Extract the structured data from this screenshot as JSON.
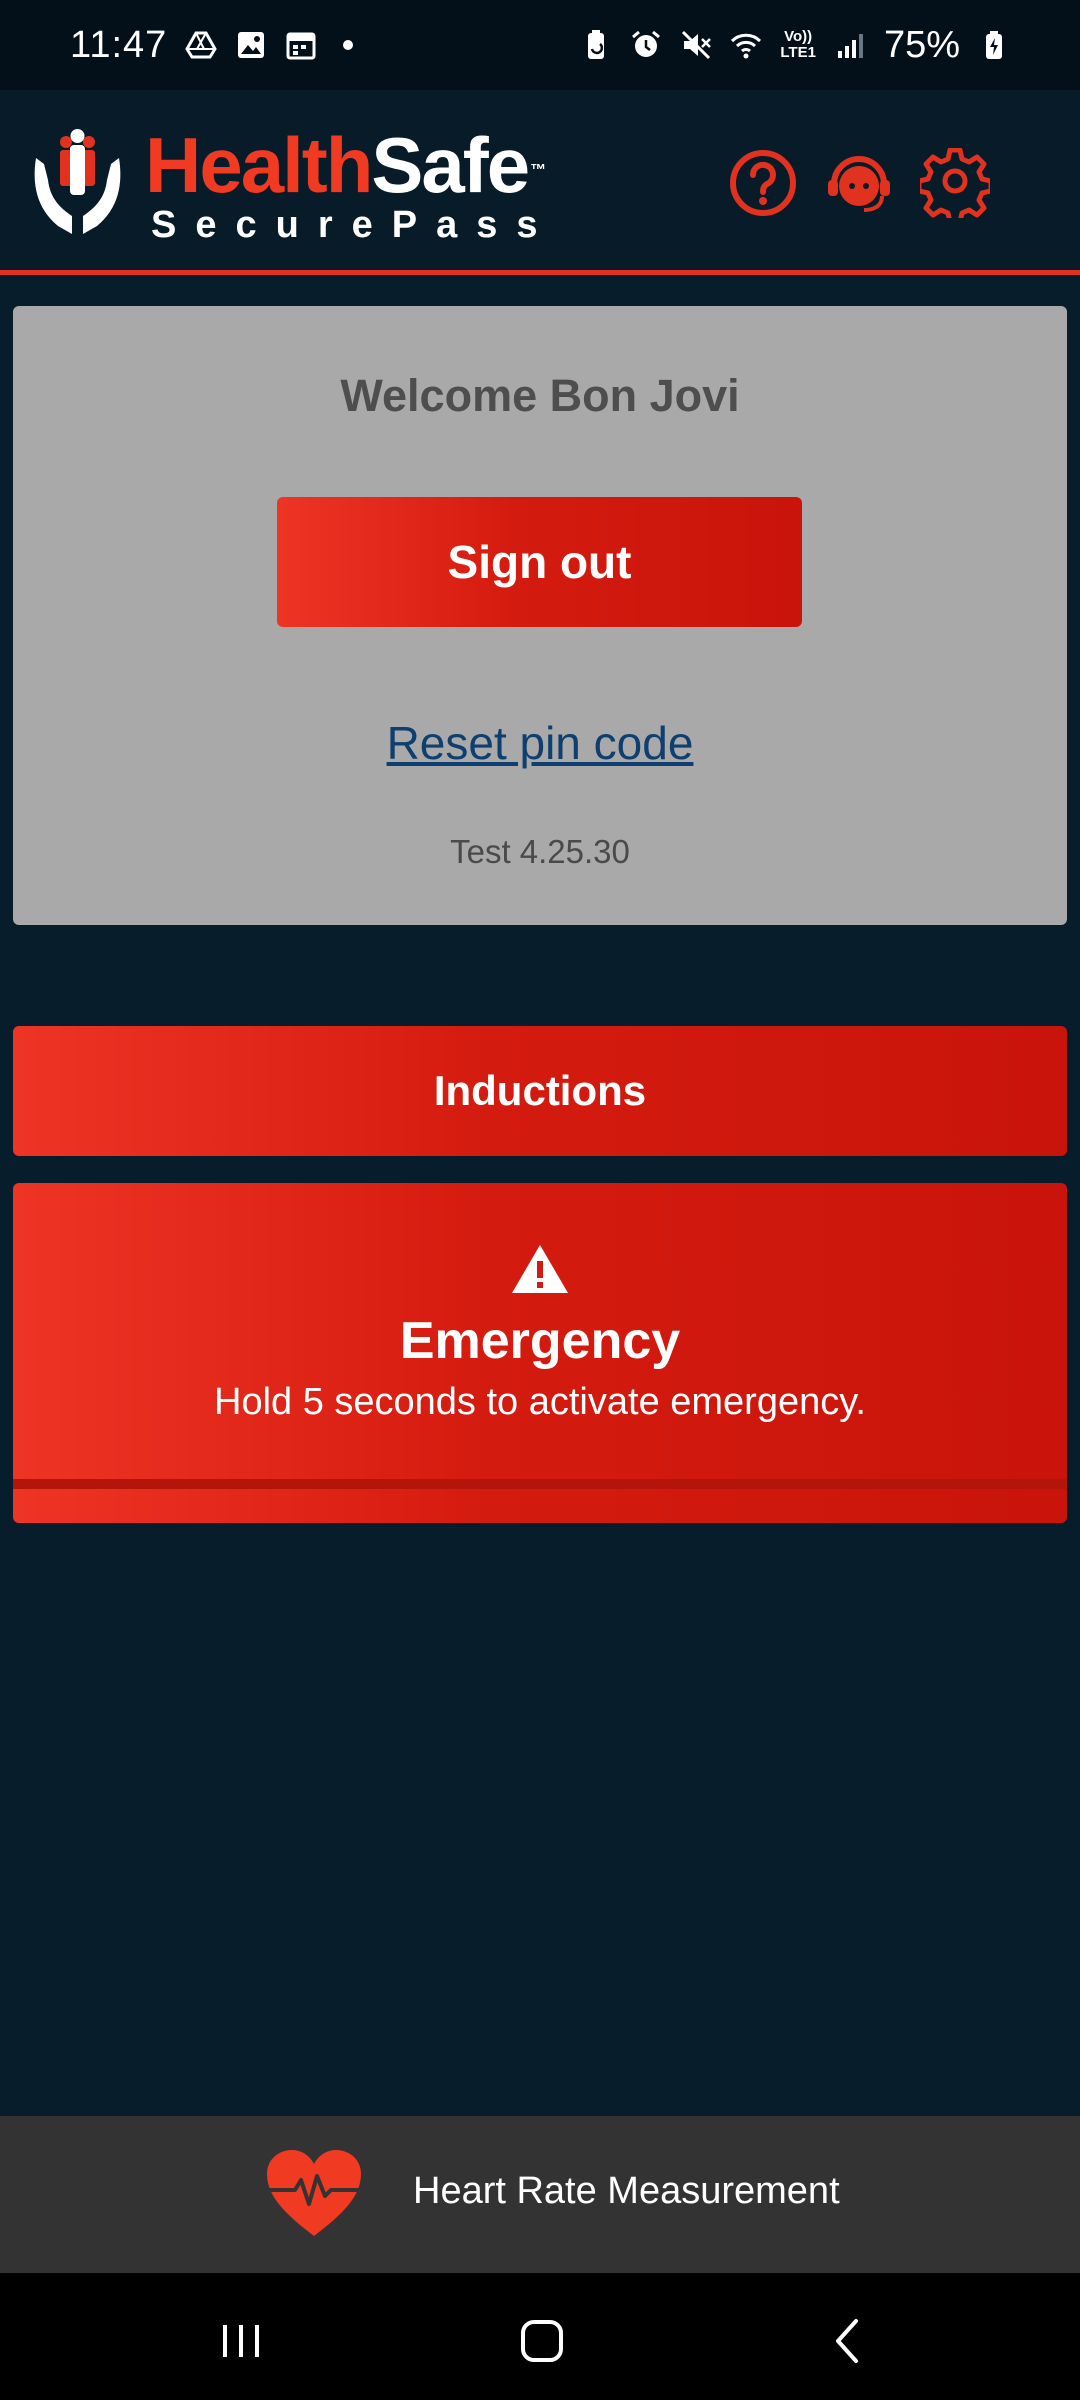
{
  "status_bar": {
    "time": "11:47",
    "battery": "75%",
    "left_icons": [
      "drive-icon",
      "gallery-icon",
      "calendar-icon",
      "dot"
    ],
    "right_icons": [
      "battery-saver-icon",
      "alarm-icon",
      "mute-icon",
      "wifi-icon",
      "volte-lte1-icon",
      "signal-icon",
      "charging-battery-icon"
    ],
    "volte_text": "Vo))",
    "lte_text": "LTE1"
  },
  "header": {
    "logo_health": "Health",
    "logo_safe": "Safe",
    "logo_tm": "™",
    "logo_sub": "SecurePass",
    "icons": [
      "help-icon",
      "support-agent-icon",
      "settings-icon"
    ]
  },
  "welcome_card": {
    "welcome_text": "Welcome Bon Jovi",
    "signout_label": "Sign out",
    "reset_label": "Reset pin code",
    "version": "Test 4.25.30"
  },
  "inductions": {
    "label": "Inductions"
  },
  "emergency": {
    "title": "Emergency",
    "subtitle": "Hold 5 seconds to activate emergency.",
    "hold_progress": 0
  },
  "heart_rate": {
    "label": "Heart Rate Measurement"
  },
  "nav": {
    "buttons": [
      "recent-apps-icon",
      "home-icon",
      "back-icon"
    ]
  },
  "colors": {
    "accent": "#e0321f",
    "background": "#071d2c",
    "card": "#a9a9a9",
    "link": "#0e3f6e"
  }
}
